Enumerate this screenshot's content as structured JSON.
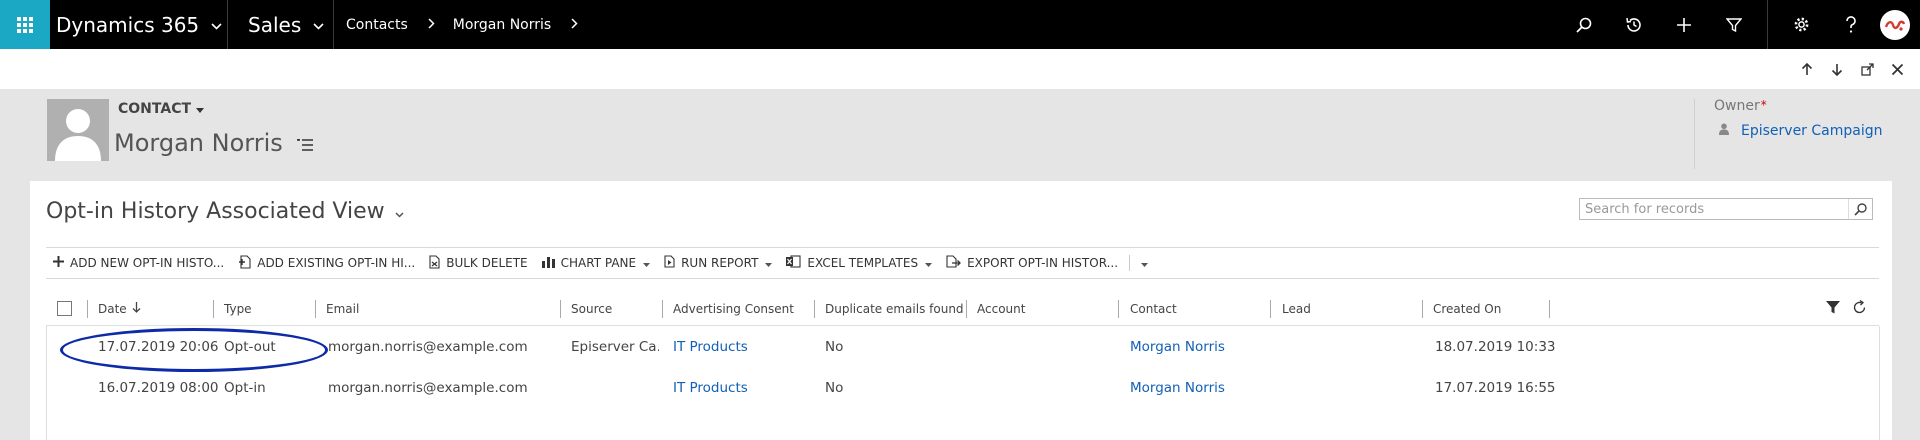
{
  "nav": {
    "app_name": "Dynamics 365",
    "area_name": "Sales",
    "breadcrumbs": [
      "Contacts",
      "Morgan Norris"
    ],
    "icons": [
      "search-icon",
      "recent-icon",
      "add-icon",
      "filter-icon",
      "gear-icon",
      "help-icon",
      "user-avatar-icon"
    ]
  },
  "record_tools": [
    "arrow-up-icon",
    "arrow-down-icon",
    "pop-out-icon",
    "close-icon"
  ],
  "header": {
    "entity_label": "CONTACT",
    "record_name": "Morgan Norris",
    "owner_label": "Owner",
    "owner_required_mark": "*",
    "owner_value": "Episerver Campaign"
  },
  "view": {
    "title": "Opt-in History Associated View",
    "search_placeholder": "Search for records"
  },
  "commands": [
    {
      "label": "ADD NEW OPT-IN HISTO...",
      "icon": "plus-icon",
      "dropdown": false
    },
    {
      "label": "ADD EXISTING OPT-IN HI...",
      "icon": "add-existing-icon",
      "dropdown": false
    },
    {
      "label": "BULK DELETE",
      "icon": "bulk-delete-icon",
      "dropdown": false
    },
    {
      "label": "CHART PANE",
      "icon": "chart-icon",
      "dropdown": true
    },
    {
      "label": "RUN REPORT",
      "icon": "report-icon",
      "dropdown": true
    },
    {
      "label": "EXCEL TEMPLATES",
      "icon": "excel-icon",
      "dropdown": true
    },
    {
      "label": "EXPORT OPT-IN HISTOR...",
      "icon": "export-icon",
      "dropdown": false
    }
  ],
  "grid": {
    "columns": [
      "Date",
      "Type",
      "Email",
      "Source",
      "Advertising Consent",
      "Duplicate emails found",
      "Account",
      "Contact",
      "Lead",
      "Created On"
    ],
    "rows": [
      {
        "date": "17.07.2019 20:06",
        "type": "Opt-out",
        "email": "morgan.norris@example.com",
        "source": "Episerver Ca...",
        "advertising_consent": "IT Products",
        "duplicate": "No",
        "account": "",
        "contact": "Morgan Norris",
        "lead": "",
        "created_on": "18.07.2019 10:33"
      },
      {
        "date": "16.07.2019 08:00",
        "type": "Opt-in",
        "email": "morgan.norris@example.com",
        "source": "",
        "advertising_consent": "IT Products",
        "duplicate": "No",
        "account": "",
        "contact": "Morgan Norris",
        "lead": "",
        "created_on": "17.07.2019 16:55"
      }
    ]
  },
  "colors": {
    "nav_bg": "#000000",
    "waffle_bg": "#1aa8c4",
    "header_bg": "#e5e5e5",
    "link": "#1160b7",
    "annotation_oval": "#0d2aa8"
  }
}
